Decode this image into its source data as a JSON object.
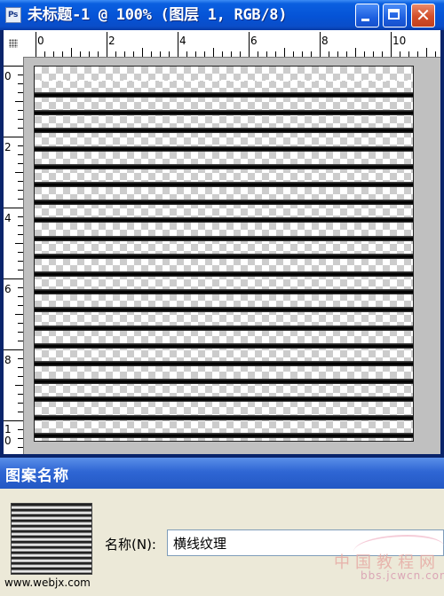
{
  "window": {
    "title": "未标题-1 @ 100% (图层 1, RGB/8)",
    "app_icon": "ps-icon",
    "app_icon_text": "Ps",
    "buttons": [
      "minimize",
      "maximize",
      "close"
    ],
    "close_glyph": "✕"
  },
  "rulers": {
    "top_labels": [
      "0",
      "2",
      "4",
      "6",
      "8",
      "10"
    ],
    "left_labels": [
      "0",
      "2",
      "4",
      "6",
      "8",
      "1\n0"
    ]
  },
  "canvas": {
    "stripe_count": 20,
    "colors": {
      "stripe": "#000000",
      "checker_light": "#ffffff",
      "checker_dark": "#cccccc"
    }
  },
  "dialog": {
    "title": "图案名称",
    "name_label": "名称(N):",
    "name_value": "横线纹理"
  },
  "watermarks": {
    "left": "www.webjx.com",
    "right_top": "中国教程网",
    "right_bottom": "bbs.jcwcn.com"
  }
}
